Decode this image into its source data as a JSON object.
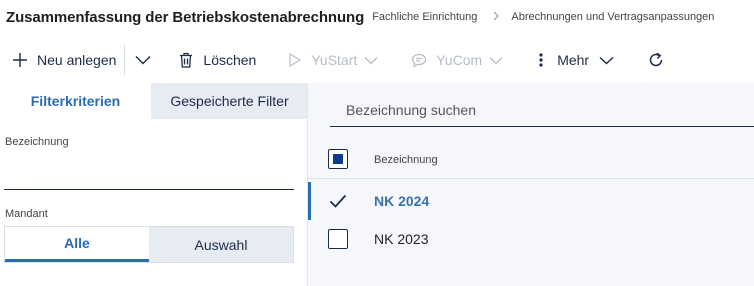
{
  "header": {
    "title": "Zusammenfassung der Betriebskostenabrechnung",
    "breadcrumb": [
      "Fachliche Einrichtung",
      "Abrechnungen und Vertragsanpassungen"
    ]
  },
  "toolbar": {
    "new_label": "Neu anlegen",
    "delete_label": "Löschen",
    "yustart_label": "YuStart",
    "yucom_label": "YuCom",
    "more_label": "Mehr"
  },
  "filter": {
    "tabs": [
      {
        "label": "Filterkriterien",
        "active": true
      },
      {
        "label": "Gespeicherte Filter",
        "active": false
      }
    ],
    "bezeichnung_label": "Bezeichnung",
    "bezeichnung_value": "",
    "mandant_label": "Mandant",
    "mandant_options": [
      {
        "label": "Alle",
        "selected": true
      },
      {
        "label": "Auswahl",
        "selected": false
      }
    ]
  },
  "list": {
    "search_placeholder": "Bezeichnung suchen",
    "column_header": "Bezeichnung",
    "rows": [
      {
        "label": "NK 2024",
        "checked": true,
        "selected": true
      },
      {
        "label": "NK 2023",
        "checked": false,
        "selected": false
      }
    ]
  },
  "colors": {
    "accent": "#2a6bb5",
    "text_dark": "#1a2b4a",
    "tab_inactive_bg": "#e7ecf3",
    "list_bg": "#f5f7fa",
    "disabled": "#b5bcc8"
  }
}
